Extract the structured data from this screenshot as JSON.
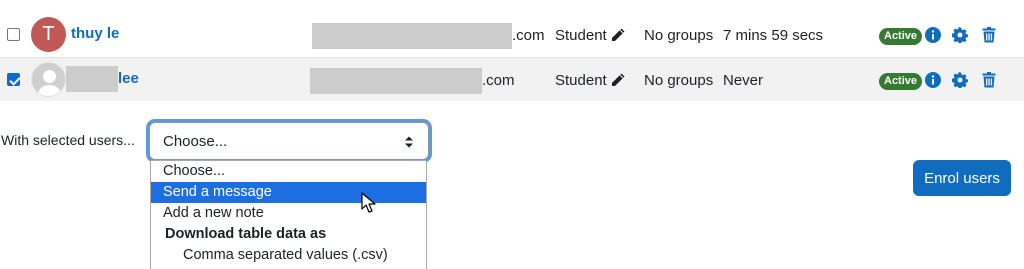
{
  "rows": [
    {
      "checked": false,
      "avatar_initial": "T",
      "name": "thuy le",
      "email_suffix": ".com",
      "role": "Student",
      "groups": "No groups",
      "last_access": "7 mins 59 secs",
      "status": "Active"
    },
    {
      "checked": true,
      "avatar_initial": "",
      "name": "lee",
      "email_suffix": ".com",
      "role": "Student",
      "groups": "No groups",
      "last_access": "Never",
      "status": "Active"
    }
  ],
  "bulk": {
    "label": "With selected users...",
    "selected": "Choose...",
    "options": [
      {
        "label": "Choose...",
        "kind": "option"
      },
      {
        "label": "Send a message",
        "kind": "option",
        "highlighted": true
      },
      {
        "label": "Add a new note",
        "kind": "option"
      },
      {
        "label": "Download table data as",
        "kind": "group"
      },
      {
        "label": "Comma separated values (.csv)",
        "kind": "child"
      }
    ]
  },
  "enrol_button": "Enrol users",
  "colors": {
    "link": "#0f6cbf",
    "badge_active": "#357a32",
    "avatar_bg": "#c15858",
    "option_highlight": "#1d6ee0",
    "focus_ring": "#5e9ad6"
  },
  "icons": [
    "pencil-icon",
    "info-icon",
    "gear-icon",
    "trash-icon",
    "select-arrows-icon",
    "mouse-cursor-icon"
  ]
}
